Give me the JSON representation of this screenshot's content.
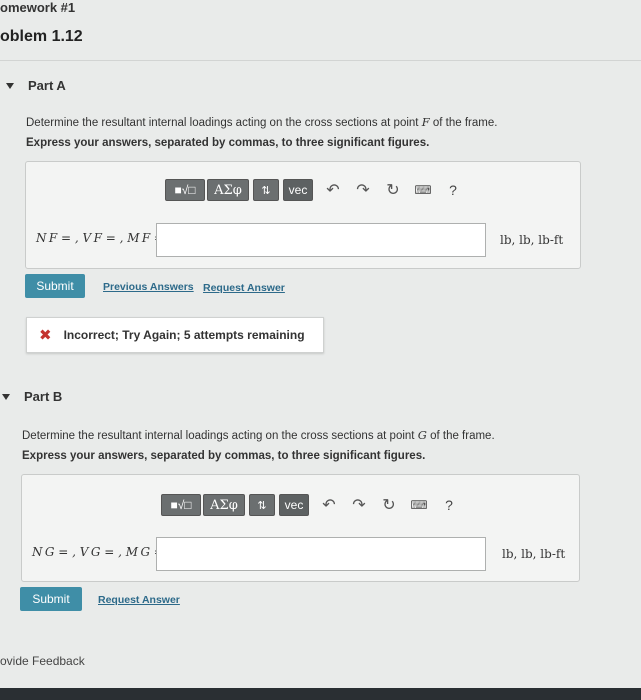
{
  "header": {
    "assignment_title": "omework #1",
    "problem_title": "oblem 1.12"
  },
  "partA": {
    "label": "Part A",
    "question_prefix": "Determine the resultant internal loadings acting on the cross sections at point ",
    "point": "F",
    "question_suffix": " of the frame.",
    "instructions": "Express your answers, separated by commas, to three significant figures.",
    "equation_label": "N F = , V F = , M F =",
    "units": "lb, lb, lb-ft",
    "submit": "Submit",
    "previous_answers": "Previous Answers",
    "request_answer": "Request Answer",
    "feedback": "Incorrect; Try Again; 5 attempts remaining"
  },
  "partB": {
    "label": "Part B",
    "question_prefix": "Determine the resultant internal loadings acting on the cross sections at point ",
    "point": "G",
    "question_suffix": " of the frame.",
    "instructions": "Express your answers, separated by commas, to three significant figures.",
    "equation_label": "N G = , V G = , M G =",
    "units": "lb, lb, lb-ft",
    "submit": "Submit",
    "request_answer": "Request Answer"
  },
  "toolbar": {
    "greek": "ΑΣφ",
    "sort": "⇅",
    "vec": "vec",
    "help": "?",
    "icons": [
      "templates-icon",
      "greek-icon",
      "sort-icon",
      "vec-icon",
      "undo-icon",
      "redo-icon",
      "reset-icon",
      "keyboard-icon",
      "help-icon"
    ]
  },
  "footer": {
    "provide_feedback": "ovide Feedback"
  }
}
